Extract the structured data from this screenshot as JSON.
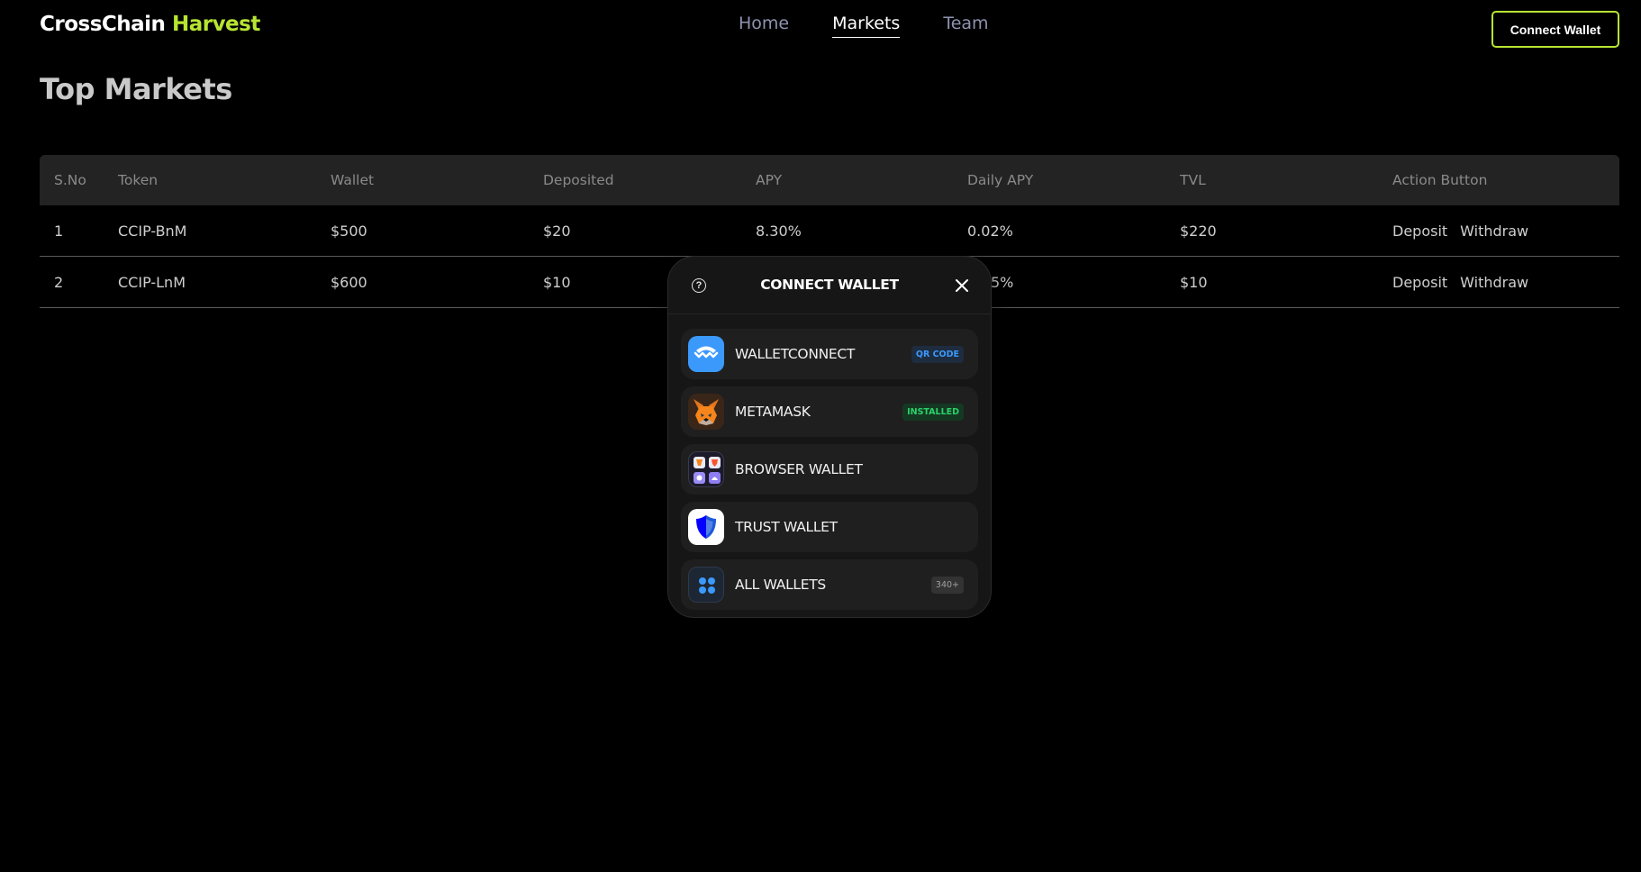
{
  "header": {
    "logo_main": "CrossChain",
    "logo_accent": "Harvest",
    "nav": [
      {
        "label": "Home",
        "active": false
      },
      {
        "label": "Markets",
        "active": true
      },
      {
        "label": "Team",
        "active": false
      }
    ],
    "connect_label": "Connect Wallet",
    "accent_color": "#b7e532"
  },
  "page": {
    "title": "Top Markets"
  },
  "table": {
    "headers": [
      "S.No",
      "Token",
      "Wallet",
      "Deposited",
      "APY",
      "Daily APY",
      "TVL",
      "Action Button"
    ],
    "rows": [
      {
        "sno": "1",
        "token": "CCIP-BnM",
        "wallet": "$500",
        "deposited": "$20",
        "apy": "8.30%",
        "daily_apy": "0.02%",
        "tvl": "$220",
        "deposit": "Deposit",
        "withdraw": "Withdraw"
      },
      {
        "sno": "2",
        "token": "CCIP-LnM",
        "wallet": "$600",
        "deposited": "$10",
        "apy": "",
        "daily_apy": "5%",
        "tvl": "$10",
        "deposit": "Deposit",
        "withdraw": "Withdraw"
      }
    ]
  },
  "modal": {
    "title": "CONNECT WALLET",
    "wallets": [
      {
        "name": "WALLETCONNECT",
        "badge": "QR CODE",
        "icon": "walletconnect-icon"
      },
      {
        "name": "METAMASK",
        "badge": "INSTALLED",
        "icon": "metamask-icon"
      },
      {
        "name": "BROWSER WALLET",
        "badge": "",
        "icon": "browser-wallet-icon"
      },
      {
        "name": "TRUST WALLET",
        "badge": "",
        "icon": "trust-wallet-icon"
      },
      {
        "name": "ALL WALLETS",
        "badge": "340+",
        "icon": "all-wallets-icon"
      }
    ]
  }
}
